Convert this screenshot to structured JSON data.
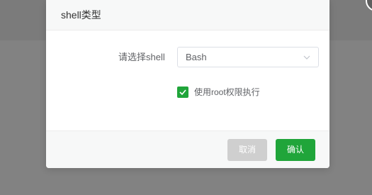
{
  "dialog": {
    "title": "shell类型",
    "form": {
      "shell_label": "请选择shell",
      "shell_selected": "Bash",
      "root_checkbox_checked": true,
      "root_checkbox_label": "使用root权限执行"
    },
    "footer": {
      "cancel_label": "取消",
      "confirm_label": "确认"
    }
  },
  "colors": {
    "accent": "#20a53a",
    "cancel_disabled": "#cfcfcf",
    "backdrop": "#808080"
  },
  "icons": {
    "close": "close-icon",
    "dropdown": "chevron-down-icon",
    "checkbox": "check-icon"
  }
}
